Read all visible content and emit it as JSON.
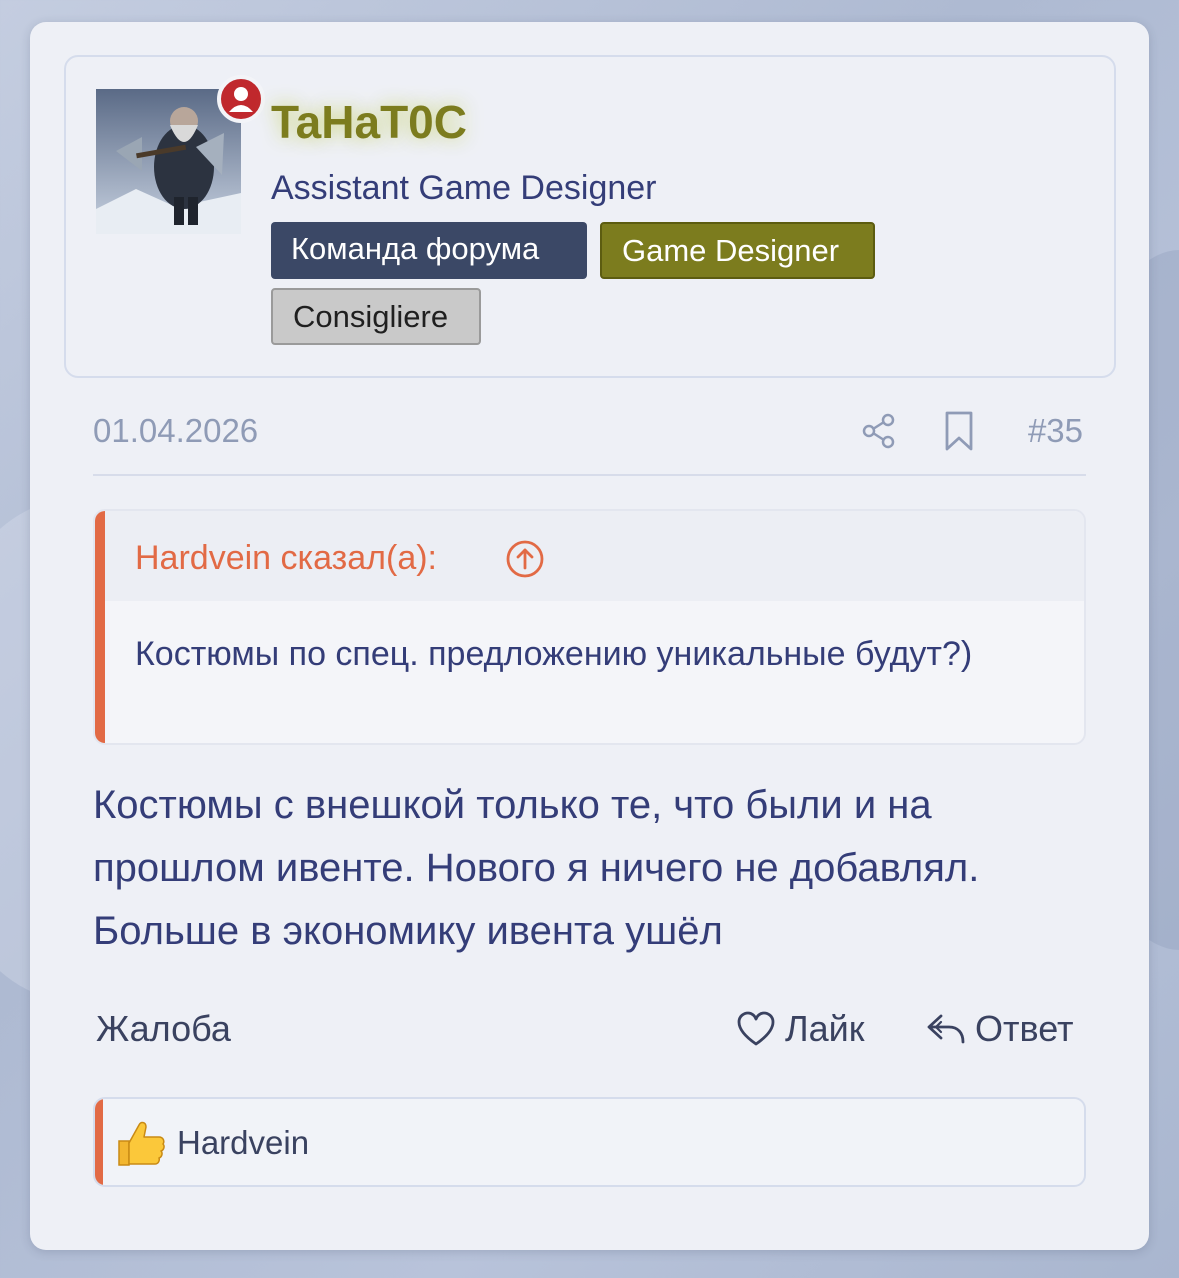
{
  "user": {
    "name": "TaHaT0C",
    "title": "Assistant Game Designer",
    "banners": [
      "Команда форума",
      "Game Designer",
      "Consigliere"
    ]
  },
  "post": {
    "date": "01.04.2026",
    "number": "#35",
    "quote_author": "Hardvein сказал(а):",
    "quote_text": "Костюмы по спец. предложению уникальные будут?)",
    "body": "Костюмы с внешкой только те, что были и на прошлом ивенте. Нового я ничего не добавлял. Больше в экономику ивента ушёл"
  },
  "actions": {
    "report": "Жалоба",
    "like": "Лайк",
    "reply": "Ответ"
  },
  "likes": {
    "names": "Hardvein"
  },
  "colors": {
    "accent": "#e26a45",
    "username": "#7c7c1e",
    "text": "#343d78"
  }
}
